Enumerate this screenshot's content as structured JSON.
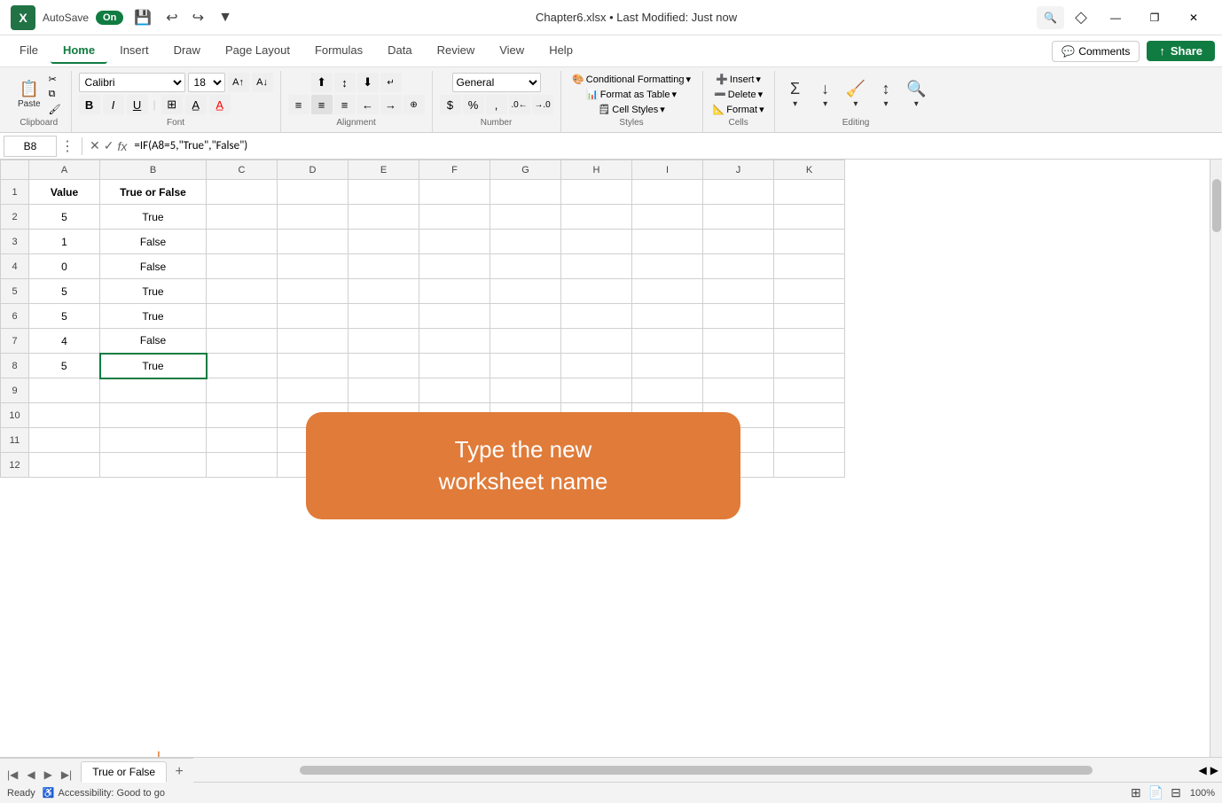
{
  "titlebar": {
    "logo": "X",
    "autosave_label": "AutoSave",
    "autosave_state": "On",
    "filename": "Chapter6.xlsx • Last Modified: Just now",
    "undo_icon": "↩",
    "redo_icon": "↪",
    "customize_icon": "▼",
    "search_placeholder": "Search"
  },
  "window_controls": {
    "minimize": "—",
    "maximize": "❐",
    "close": "✕",
    "diamond": "◇"
  },
  "menu": {
    "tabs": [
      "File",
      "Home",
      "Insert",
      "Draw",
      "Page Layout",
      "Formulas",
      "Data",
      "Review",
      "View",
      "Help"
    ],
    "active_tab": "Home",
    "comments_label": "Comments",
    "share_label": "Share"
  },
  "ribbon": {
    "clipboard": {
      "paste_label": "Paste",
      "cut_icon": "✂",
      "copy_icon": "⧉",
      "format_painter_icon": "🖌"
    },
    "font": {
      "font_name": "Calibri",
      "font_size": "18",
      "bold": "B",
      "italic": "I",
      "underline": "U",
      "increase_font": "A↑",
      "decrease_font": "A↓"
    },
    "alignment": {
      "align_left": "≡",
      "align_center": "≡",
      "align_right": "≡"
    },
    "number": {
      "format": "General",
      "percent": "%",
      "comma": ","
    },
    "styles": {
      "conditional_formatting": "Conditional Formatting",
      "format_as_table": "Format as Table",
      "cell_styles": "Cell Styles"
    },
    "cells": {
      "insert": "Insert",
      "delete": "Delete",
      "format": "Format"
    },
    "editing": {
      "sum": "Σ",
      "fill": "↓",
      "clear": "✕",
      "sort": "↕",
      "find": "🔍"
    },
    "groups": [
      "Clipboard",
      "Font",
      "Alignment",
      "Number",
      "Styles",
      "Cells",
      "Editing"
    ]
  },
  "formula_bar": {
    "cell_ref": "B8",
    "cancel_icon": "✕",
    "confirm_icon": "✓",
    "fx_icon": "fx",
    "formula": "=IF(A8=5,\"True\",\"False\")"
  },
  "spreadsheet": {
    "columns": [
      "A",
      "B",
      "C",
      "D",
      "E",
      "F",
      "G",
      "H",
      "I",
      "J",
      "K"
    ],
    "rows": [
      {
        "row": 1,
        "A": "Value",
        "B": "True or False",
        "A_bold": true,
        "B_bold": true
      },
      {
        "row": 2,
        "A": "5",
        "B": "True"
      },
      {
        "row": 3,
        "A": "1",
        "B": "False"
      },
      {
        "row": 4,
        "A": "0",
        "B": "False"
      },
      {
        "row": 5,
        "A": "5",
        "B": "True"
      },
      {
        "row": 6,
        "A": "5",
        "B": "True"
      },
      {
        "row": 7,
        "A": "4",
        "B": "False"
      },
      {
        "row": 8,
        "A": "5",
        "B": "True",
        "B_selected": true
      },
      {
        "row": 9,
        "A": "",
        "B": ""
      },
      {
        "row": 10,
        "A": "",
        "B": ""
      },
      {
        "row": 11,
        "A": "",
        "B": ""
      },
      {
        "row": 12,
        "A": "",
        "B": ""
      }
    ]
  },
  "annotation": {
    "text": "Type the new\nworksheet name",
    "arrow": "↓"
  },
  "sheet_tabs": {
    "tabs": [
      "True or False"
    ],
    "active_tab": "True or False",
    "add_label": "+"
  },
  "status_bar": {
    "status": "Ready",
    "accessibility": "Accessibility: Good to go",
    "zoom": "100%"
  }
}
